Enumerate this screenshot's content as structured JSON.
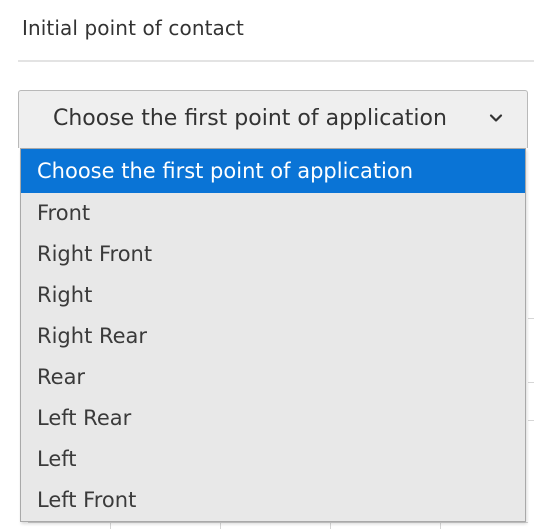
{
  "section": {
    "label": "Initial point of contact"
  },
  "select": {
    "current_value": "Choose the first point of application",
    "chevron_icon": "chevron-down-icon",
    "options": [
      {
        "label": "Choose the first point of application",
        "selected": true
      },
      {
        "label": "Front",
        "selected": false
      },
      {
        "label": "Right Front",
        "selected": false
      },
      {
        "label": "Right",
        "selected": false
      },
      {
        "label": "Right Rear",
        "selected": false
      },
      {
        "label": "Rear",
        "selected": false
      },
      {
        "label": "Left Rear",
        "selected": false
      },
      {
        "label": "Left",
        "selected": false
      },
      {
        "label": "Left Front",
        "selected": false
      }
    ]
  },
  "colors": {
    "highlight": "#0a74d6",
    "highlight_text": "#ffffff",
    "list_background": "#e8e8e8",
    "text": "#333333"
  }
}
